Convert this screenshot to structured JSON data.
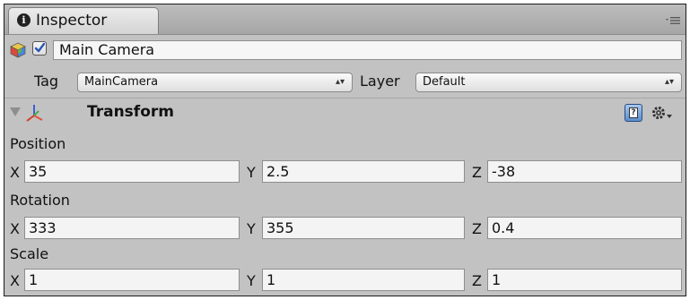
{
  "tab": {
    "title": "Inspector",
    "icon": "info-icon"
  },
  "menu_icon": "panel-menu-icon",
  "game_object": {
    "icon": "cube-icon",
    "active_checked": true,
    "name": "Main Camera"
  },
  "tag_row": {
    "tag_label": "Tag",
    "tag_value": "MainCamera",
    "layer_label": "Layer",
    "layer_value": "Default",
    "popup_arrows": "▴▾"
  },
  "transform": {
    "title": "Transform",
    "icons": [
      "foldout-arrow-icon",
      "transform-axis-icon",
      "help-reference-icon",
      "gear-dropdown-icon"
    ],
    "help_glyph": "?",
    "position": {
      "label": "Position",
      "x_label": "X",
      "y_label": "Y",
      "z_label": "Z",
      "x": "35",
      "y": "2.5",
      "z": "-38"
    },
    "rotation": {
      "label": "Rotation",
      "x_label": "X",
      "y_label": "Y",
      "z_label": "Z",
      "x": "333",
      "y": "355",
      "z": "0.4"
    },
    "scale": {
      "label": "Scale",
      "x_label": "X",
      "y_label": "Y",
      "z_label": "Z",
      "x": "1",
      "y": "1",
      "z": "1"
    }
  }
}
